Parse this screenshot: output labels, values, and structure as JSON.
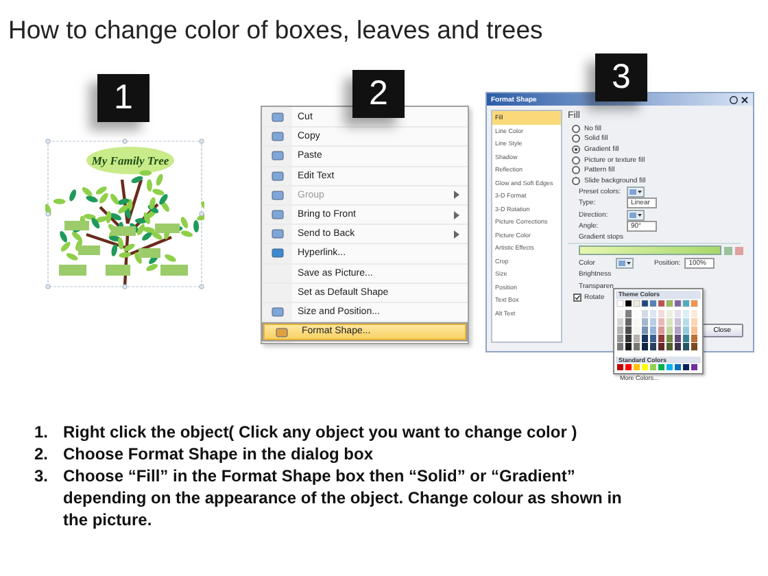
{
  "title": "How to change color of boxes, leaves and trees",
  "tree_panel": {
    "badge": "1",
    "banner": "My Family Tree"
  },
  "menu_panel": {
    "badge": "2",
    "items": [
      {
        "label": "Cut",
        "disabled": false,
        "submenu": false,
        "selected": false
      },
      {
        "label": "Copy",
        "disabled": false,
        "submenu": false,
        "selected": false
      },
      {
        "label": "Paste",
        "disabled": false,
        "submenu": false,
        "selected": false
      },
      {
        "label": "Edit Text",
        "disabled": false,
        "submenu": false,
        "selected": false
      },
      {
        "label": "Group",
        "disabled": true,
        "submenu": true,
        "selected": false
      },
      {
        "label": "Bring to Front",
        "disabled": false,
        "submenu": true,
        "selected": false
      },
      {
        "label": "Send to Back",
        "disabled": false,
        "submenu": true,
        "selected": false
      },
      {
        "label": "Hyperlink...",
        "disabled": false,
        "submenu": false,
        "selected": false
      },
      {
        "label": "Save as Picture...",
        "disabled": false,
        "submenu": false,
        "selected": false
      },
      {
        "label": "Set as Default Shape",
        "disabled": false,
        "submenu": false,
        "selected": false
      },
      {
        "label": "Size and Position...",
        "disabled": false,
        "submenu": false,
        "selected": false
      },
      {
        "label": "Format Shape...",
        "disabled": false,
        "submenu": false,
        "selected": true
      }
    ]
  },
  "dialog_panel": {
    "badge": "3",
    "title": "Format Shape",
    "categories": [
      {
        "label": "Fill",
        "selected": true
      },
      {
        "label": "Line Color",
        "selected": false
      },
      {
        "label": "Line Style",
        "selected": false
      },
      {
        "label": "Shadow",
        "selected": false
      },
      {
        "label": "Reflection",
        "selected": false
      },
      {
        "label": "Glow and Soft Edges",
        "selected": false
      },
      {
        "label": "3-D Format",
        "selected": false
      },
      {
        "label": "3-D Rotation",
        "selected": false
      },
      {
        "label": "Picture Corrections",
        "selected": false
      },
      {
        "label": "Picture Color",
        "selected": false
      },
      {
        "label": "Artistic Effects",
        "selected": false
      },
      {
        "label": "Crop",
        "selected": false
      },
      {
        "label": "Size",
        "selected": false
      },
      {
        "label": "Position",
        "selected": false
      },
      {
        "label": "Text Box",
        "selected": false
      },
      {
        "label": "Alt Text",
        "selected": false
      }
    ],
    "section": "Fill",
    "fill_options": [
      {
        "label": "No fill",
        "selected": false
      },
      {
        "label": "Solid fill",
        "selected": false
      },
      {
        "label": "Gradient fill",
        "selected": true
      },
      {
        "label": "Picture or texture fill",
        "selected": false
      },
      {
        "label": "Pattern fill",
        "selected": false
      },
      {
        "label": "Slide background fill",
        "selected": false
      }
    ],
    "preset_label": "Preset colors:",
    "type_label": "Type:",
    "type_value": "Linear",
    "direction_label": "Direction:",
    "angle_label": "Angle:",
    "angle_value": "90°",
    "stops_label": "Gradient stops",
    "color_label": "Color",
    "position_label": "Position:",
    "position_value": "100%",
    "brightness_label": "Brightness",
    "transparency_label": "Transparen",
    "rotate_label": "Rotate",
    "rotate_checked": true,
    "close": "Close",
    "popup": {
      "theme_label": "Theme Colors",
      "standard_label": "Standard Colors",
      "more": "More Colors..."
    }
  },
  "steps": [
    {
      "number": "1.",
      "text": "Right click the object( Click any object you want to change color )"
    },
    {
      "number": "2.",
      "text": "Choose Format Shape in the dialog box"
    },
    {
      "number": "3.",
      "text": "Choose “Fill” in the Format Shape box then “Solid” or “Gradient” depending on the appearance of the object. Change colour as shown in the picture."
    }
  ]
}
